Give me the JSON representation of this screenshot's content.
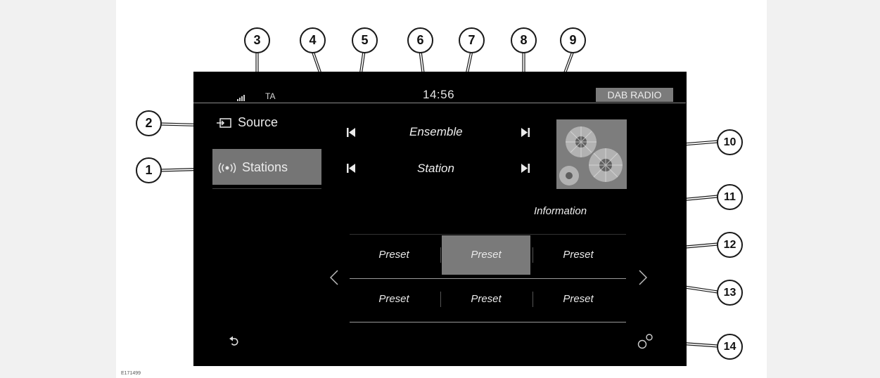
{
  "status_bar": {
    "ta": "TA",
    "clock": "14:56",
    "mode_badge": "DAB RADIO"
  },
  "menu": {
    "source_label": "Source",
    "stations_label": "Stations"
  },
  "now_playing": {
    "ensemble": "Ensemble",
    "station": "Station",
    "information": "Information"
  },
  "presets": [
    {
      "label": "Preset",
      "selected": false
    },
    {
      "label": "Preset",
      "selected": true
    },
    {
      "label": "Preset",
      "selected": false
    },
    {
      "label": "Preset",
      "selected": false
    },
    {
      "label": "Preset",
      "selected": false
    },
    {
      "label": "Preset",
      "selected": false
    }
  ],
  "callouts": [
    "1",
    "2",
    "3",
    "4",
    "5",
    "6",
    "7",
    "8",
    "9",
    "10",
    "11",
    "12",
    "13",
    "14"
  ],
  "figure_code": "E171499",
  "colors": {
    "screen_bg": "#000000",
    "selected_bg": "#757575",
    "text": "#ececec"
  },
  "icons": [
    "signal-icon",
    "source-icon",
    "stations-icon",
    "skip-back-icon",
    "skip-forward-icon",
    "chevron-left-icon",
    "chevron-right-icon",
    "back-icon",
    "settings-icon"
  ]
}
